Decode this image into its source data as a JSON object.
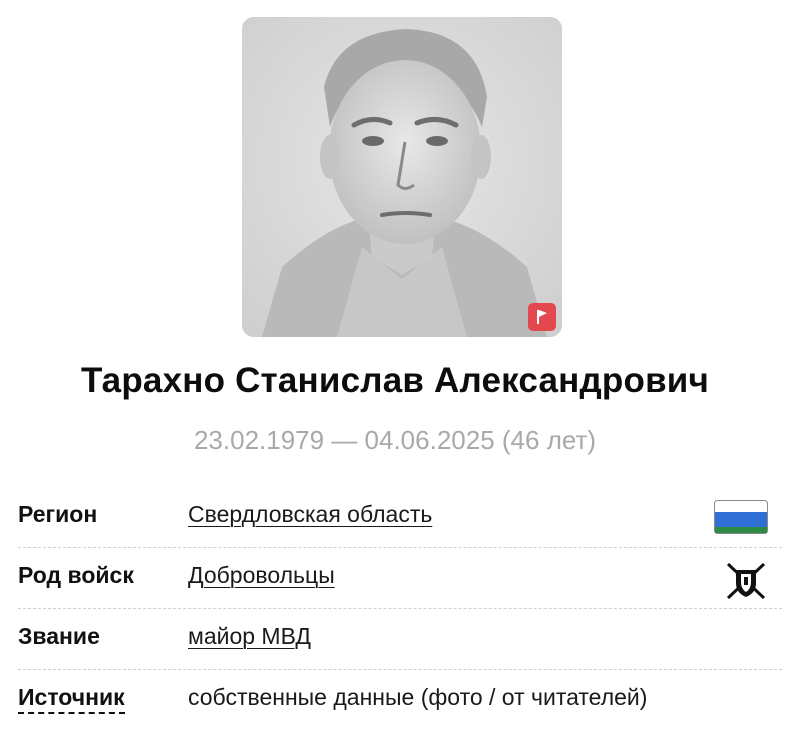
{
  "person": {
    "name": "Тарахно Станислав Александрович",
    "dates": "23.02.1979 — 04.06.2025 (46 лет)"
  },
  "info": {
    "rows": [
      {
        "label": "Регион",
        "value": "Свердловская область",
        "icon": "sverdlovsk-flag-icon"
      },
      {
        "label": "Род войск",
        "value": "Добровольцы",
        "icon": "volunteers-emblem-icon"
      },
      {
        "label": "Звание",
        "value": "майор МВД"
      },
      {
        "label": "Источник",
        "value": "собственные данные (фото / от читателей)"
      }
    ]
  },
  "colors": {
    "flag_badge": "#e4474d",
    "dates_text": "#a9a9a9",
    "flag_white": "#ffffff",
    "flag_blue": "#2f6fd6",
    "flag_green": "#2e8b45"
  },
  "icons": {
    "report": "flag-icon"
  }
}
